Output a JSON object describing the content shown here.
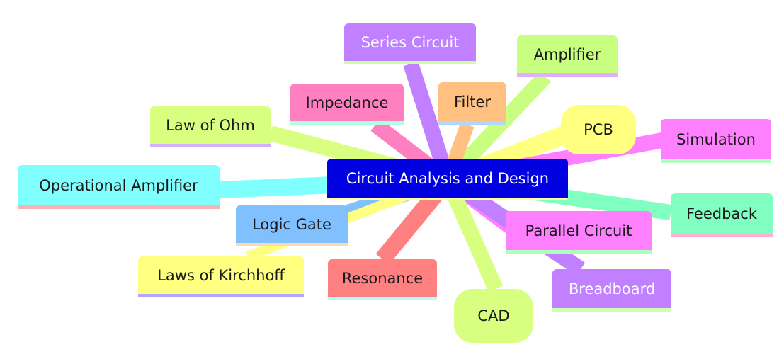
{
  "center": {
    "label": "Circuit Analysis and Design",
    "color": "#0000e0"
  },
  "nodes": [
    {
      "id": "series-circuit",
      "label": "Series Circuit",
      "color": "#c080ff",
      "underline": "#c8ffa0",
      "text": "light"
    },
    {
      "id": "amplifier",
      "label": "Amplifier",
      "color": "#c8ff80",
      "underline": "#e0b0ff",
      "text": "dark"
    },
    {
      "id": "impedance",
      "label": "Impedance",
      "color": "#ff80c0",
      "underline": "#b0ffe0",
      "text": "dark"
    },
    {
      "id": "filter",
      "label": "Filter",
      "color": "#ffc080",
      "underline": "#b0d8ff",
      "text": "dark"
    },
    {
      "id": "pcb",
      "label": "PCB",
      "color": "#ffff80",
      "underline": "",
      "text": "dark"
    },
    {
      "id": "law-of-ohm",
      "label": "Law of Ohm",
      "color": "#d8ff80",
      "underline": "#d0b0ff",
      "text": "dark"
    },
    {
      "id": "simulation",
      "label": "Simulation",
      "color": "#ff80ff",
      "underline": "#b0ffc0",
      "text": "dark"
    },
    {
      "id": "operational-amplifier",
      "label": "Operational Amplifier",
      "color": "#80ffff",
      "underline": "#ffb0b0",
      "text": "dark"
    },
    {
      "id": "feedback",
      "label": "Feedback",
      "color": "#80ffc0",
      "underline": "#ffb0d0",
      "text": "dark"
    },
    {
      "id": "logic-gate",
      "label": "Logic Gate",
      "color": "#80c0ff",
      "underline": "#ffd8b0",
      "text": "dark"
    },
    {
      "id": "parallel-circuit",
      "label": "Parallel Circuit",
      "color": "#ff80ff",
      "underline": "#b0ffc0",
      "text": "dark"
    },
    {
      "id": "laws-of-kirchhoff",
      "label": "Laws of Kirchhoff",
      "color": "#ffff80",
      "underline": "#b0a8ff",
      "text": "dark"
    },
    {
      "id": "resonance",
      "label": "Resonance",
      "color": "#ff8080",
      "underline": "#b0ffff",
      "text": "dark"
    },
    {
      "id": "breadboard",
      "label": "Breadboard",
      "color": "#c080ff",
      "underline": "#d0ffb0",
      "text": "light"
    },
    {
      "id": "cad",
      "label": "CAD",
      "color": "#d8ff80",
      "underline": "",
      "text": "dark"
    }
  ]
}
